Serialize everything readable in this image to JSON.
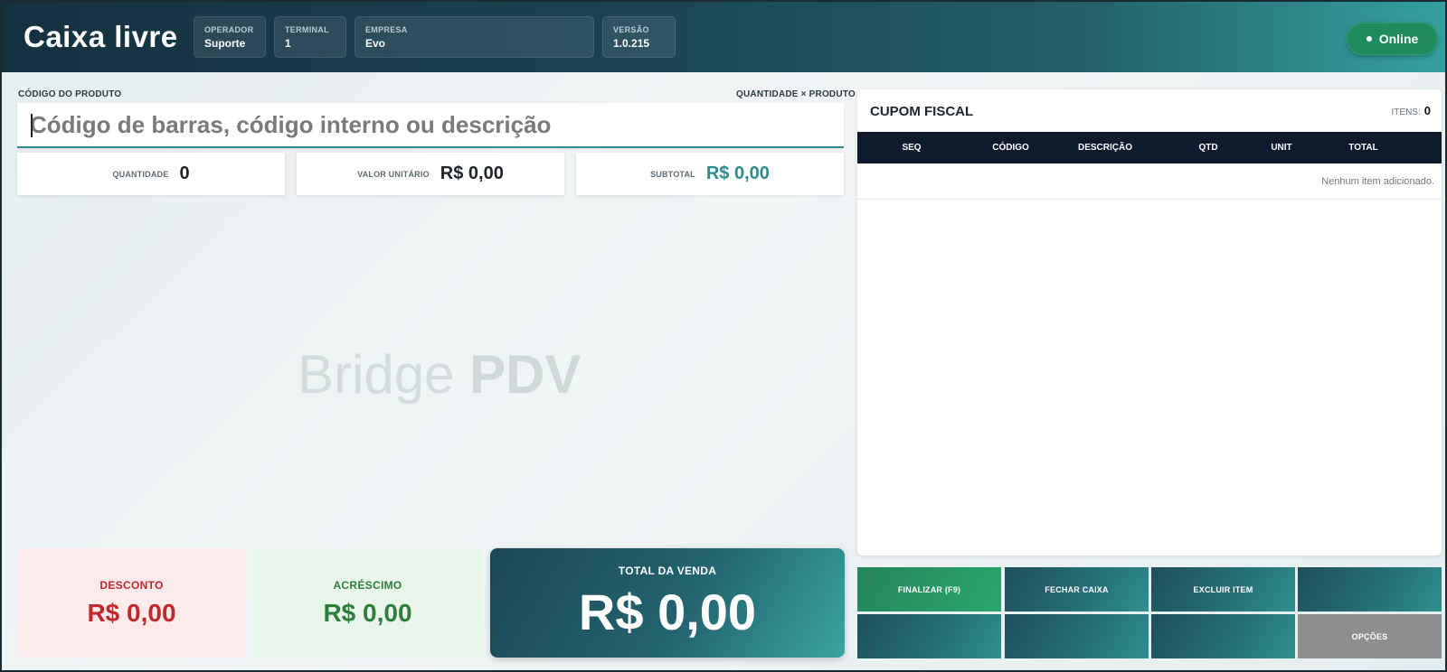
{
  "header": {
    "title": "Caixa livre",
    "info": [
      {
        "label": "OPERADOR",
        "value": "Suporte"
      },
      {
        "label": "TERMINAL",
        "value": "1"
      },
      {
        "label": "EMPRESA",
        "value": "Evo"
      },
      {
        "label": "VERSÃO",
        "value": "1.0.215"
      }
    ],
    "status": "Online",
    "status_color": "#1f8a5b"
  },
  "product": {
    "code_label": "CÓDIGO DO PRODUTO",
    "qty_hint": "QUANTIDADE × PRODUTO",
    "search_placeholder": "Código de barras, código interno ou descrição",
    "search_value": ""
  },
  "metrics": {
    "quantity_label": "QUANTIDADE",
    "quantity_value": "0",
    "unit_label": "VALOR UNITÁRIO",
    "unit_value": "R$ 0,00",
    "subtotal_label": "SUBTOTAL",
    "subtotal_value": "R$ 0,00"
  },
  "watermark": {
    "light": "Bridge",
    "bold": "PDV"
  },
  "summary": {
    "discount_label": "DESCONTO",
    "discount_value": "R$ 0,00",
    "surcharge_label": "ACRÉSCIMO",
    "surcharge_value": "R$ 0,00",
    "total_label": "TOTAL DA VENDA",
    "total_value": "R$ 0,00"
  },
  "coupon": {
    "title": "CUPOM FISCAL",
    "items_label": "ITENS:",
    "items_count": "0",
    "columns": [
      "SEQ",
      "CÓDIGO",
      "DESCRIÇÃO",
      "QTD",
      "UNIT",
      "TOTAL"
    ],
    "empty_message": "Nenhum item adicionado."
  },
  "actions": {
    "finalize": "FINALIZAR (F9)",
    "close_register": "FECHAR CAIXA",
    "delete_item": "EXCLUIR ITEM",
    "options": "OPÇÕES"
  },
  "colors": {
    "accent_teal": "#2e8c8c",
    "header_dark": "#15313f",
    "discount_red": "#c0282d",
    "surcharge_green": "#2e7d3a",
    "table_head": "#0f1a2c"
  }
}
